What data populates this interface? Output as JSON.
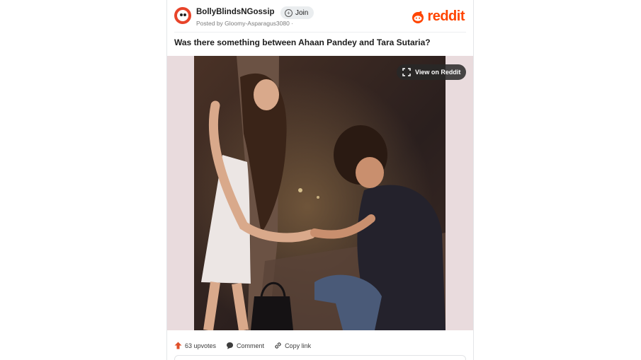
{
  "post": {
    "subreddit": "BollyBlindsNGossip",
    "join_label": "Join",
    "posted_by": "Posted by Gloomy-Asparagus3080 ·",
    "brand": "reddit",
    "title": "Was there something between Ahaan Pandey and Tara Sutaria?",
    "view_on_reddit": "View on Reddit",
    "upvotes": "63 upvotes",
    "comment_label": "Comment",
    "copy_link_label": "Copy link"
  },
  "colors": {
    "brand_orange": "#ff4500",
    "subreddit_avatar": "#e8442a",
    "upvote_icon": "#e0502a"
  },
  "icons": [
    "subreddit-avatar",
    "join-plus-icon",
    "reddit-logo-icon",
    "expand-icon",
    "upvote-icon",
    "comment-icon",
    "link-icon"
  ]
}
